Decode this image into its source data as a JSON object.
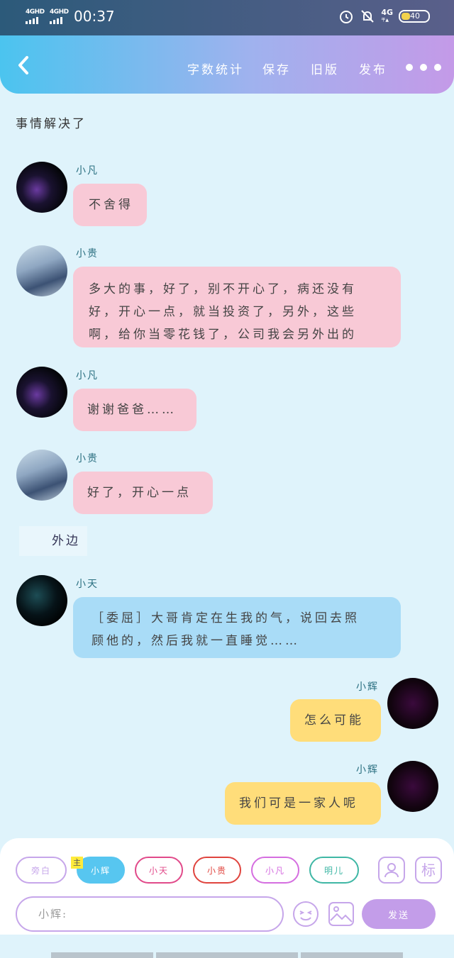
{
  "status": {
    "signal1": "4GHD",
    "signal2": "4GHD",
    "time": "00:37",
    "network": "4G",
    "network_sub": "平▲",
    "battery": "40"
  },
  "nav": {
    "items": [
      "字数统计",
      "保存",
      "旧版",
      "发布"
    ]
  },
  "plain_text": "事情解决了",
  "messages": [
    {
      "name": "小凡",
      "text": "不舍得"
    },
    {
      "name": "小贵",
      "lines": [
        "多大的事，好了，别不开心了，病还没有",
        "好，开心一点，就当投资了，另外，这些",
        "啊，给你当零花钱了，公司我会另外出的"
      ]
    },
    {
      "name": "小凡",
      "text": "谢谢爸爸……"
    },
    {
      "name": "小贵",
      "text": "好了，开心一点"
    },
    {
      "name": "小天",
      "lines": [
        "［委屈］大哥肯定在生我的气，说回去照",
        "顾他的，然后我就一直睡觉……"
      ]
    },
    {
      "name": "小辉",
      "text": "怎么可能"
    },
    {
      "name": "小辉",
      "text": "我们可是一家人呢"
    }
  ],
  "scene_tag": "外边",
  "composer": {
    "roles": [
      "旁白",
      "小辉",
      "小天",
      "小贵",
      "小凡",
      "明儿"
    ],
    "main_badge": "主",
    "tag_button": "标",
    "input_placeholder": "小辉:",
    "send_label": "发送"
  },
  "colors": {
    "accent_purple": "#c39de9",
    "accent_blue": "#57c6f0",
    "bubble_pink": "#f8c9d6",
    "bubble_blue": "#a9dcf7",
    "bubble_yellow": "#ffdd7a"
  }
}
